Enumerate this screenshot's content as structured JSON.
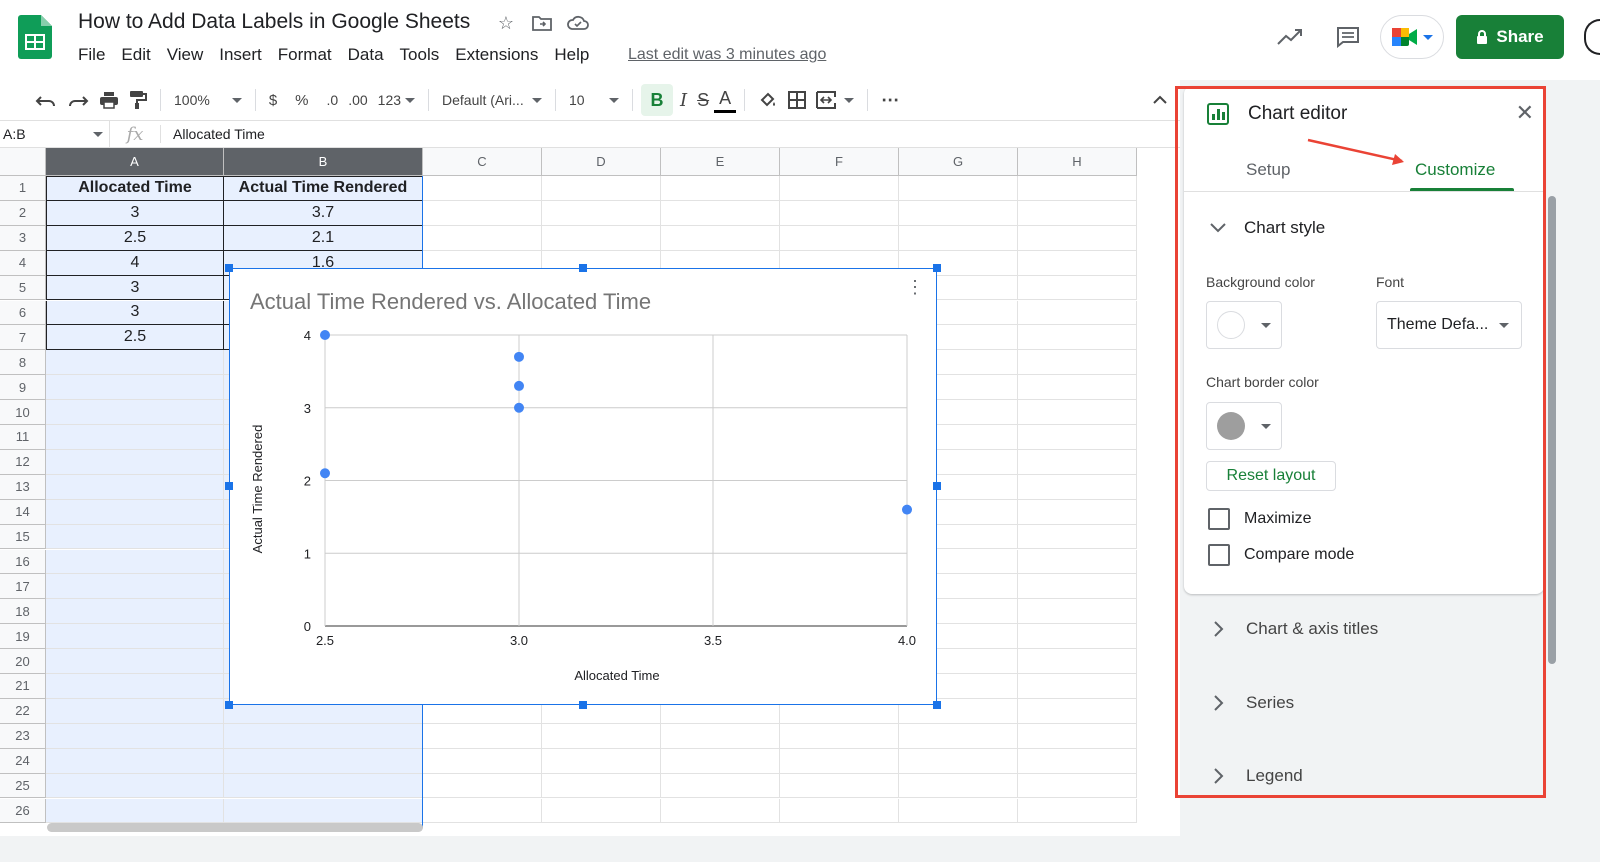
{
  "app": {
    "doc_title": "How to Add Data Labels in Google Sheets",
    "menus": [
      "File",
      "Edit",
      "View",
      "Insert",
      "Format",
      "Data",
      "Tools",
      "Extensions",
      "Help"
    ],
    "last_edit": "Last edit was 3 minutes ago",
    "share_label": "Share",
    "brand_green": "#188038"
  },
  "toolbar": {
    "zoom": "100%",
    "currency": "$",
    "percent": "%",
    "decrease_decimal": ".0",
    "increase_decimal": ".00",
    "number_format": "123",
    "font": "Default (Ari...",
    "font_size": "10",
    "bold": "B",
    "italic": "I",
    "strike": "S",
    "text_color": "A",
    "more": "⋯"
  },
  "formula_bar": {
    "name_box": "A:B",
    "fx": "fx",
    "value": "Allocated Time"
  },
  "grid": {
    "columns": [
      "A",
      "B",
      "C",
      "D",
      "E",
      "F",
      "G",
      "H"
    ],
    "rows": [
      "1",
      "2",
      "3",
      "4",
      "5",
      "6",
      "7",
      "8",
      "9",
      "10",
      "11",
      "12",
      "13",
      "14",
      "15",
      "16",
      "17",
      "18",
      "19",
      "20",
      "21",
      "22",
      "23",
      "24",
      "25",
      "26"
    ],
    "header_a": "Allocated Time",
    "header_b": "Actual Time Rendered",
    "col_a": [
      "3",
      "2.5",
      "4",
      "3",
      "3",
      "2.5"
    ],
    "col_b": [
      "3.7",
      "2.1",
      "1.6"
    ]
  },
  "chart_data": {
    "type": "scatter",
    "title": "Actual Time Rendered vs. Allocated Time",
    "xlabel": "Allocated Time",
    "ylabel": "Actual Time Rendered",
    "xlim": [
      2.5,
      4.0
    ],
    "ylim": [
      0,
      4
    ],
    "x_ticks": [
      "2.5",
      "3.0",
      "3.5",
      "4.0"
    ],
    "y_ticks": [
      "0",
      "1",
      "2",
      "3",
      "4"
    ],
    "grid": true,
    "color": "#4285f4",
    "series": [
      {
        "x": [
          2.5,
          2.5,
          3.0,
          3.0,
          3.0,
          4.0
        ],
        "y": [
          4.0,
          2.1,
          3.7,
          3.3,
          3.0,
          1.6
        ]
      }
    ]
  },
  "editor": {
    "title": "Chart editor",
    "tabs": [
      "Setup",
      "Customize"
    ],
    "active_tab": "Customize",
    "chart_style": "Chart style",
    "background_color_label": "Background color",
    "font_label": "Font",
    "font_value": "Theme Defa...",
    "border_color_label": "Chart border color",
    "reset_layout": "Reset layout",
    "maximize": "Maximize",
    "compare_mode": "Compare mode",
    "sections": [
      "Chart & axis titles",
      "Series",
      "Legend"
    ],
    "annotation_color": "#ea4335"
  }
}
